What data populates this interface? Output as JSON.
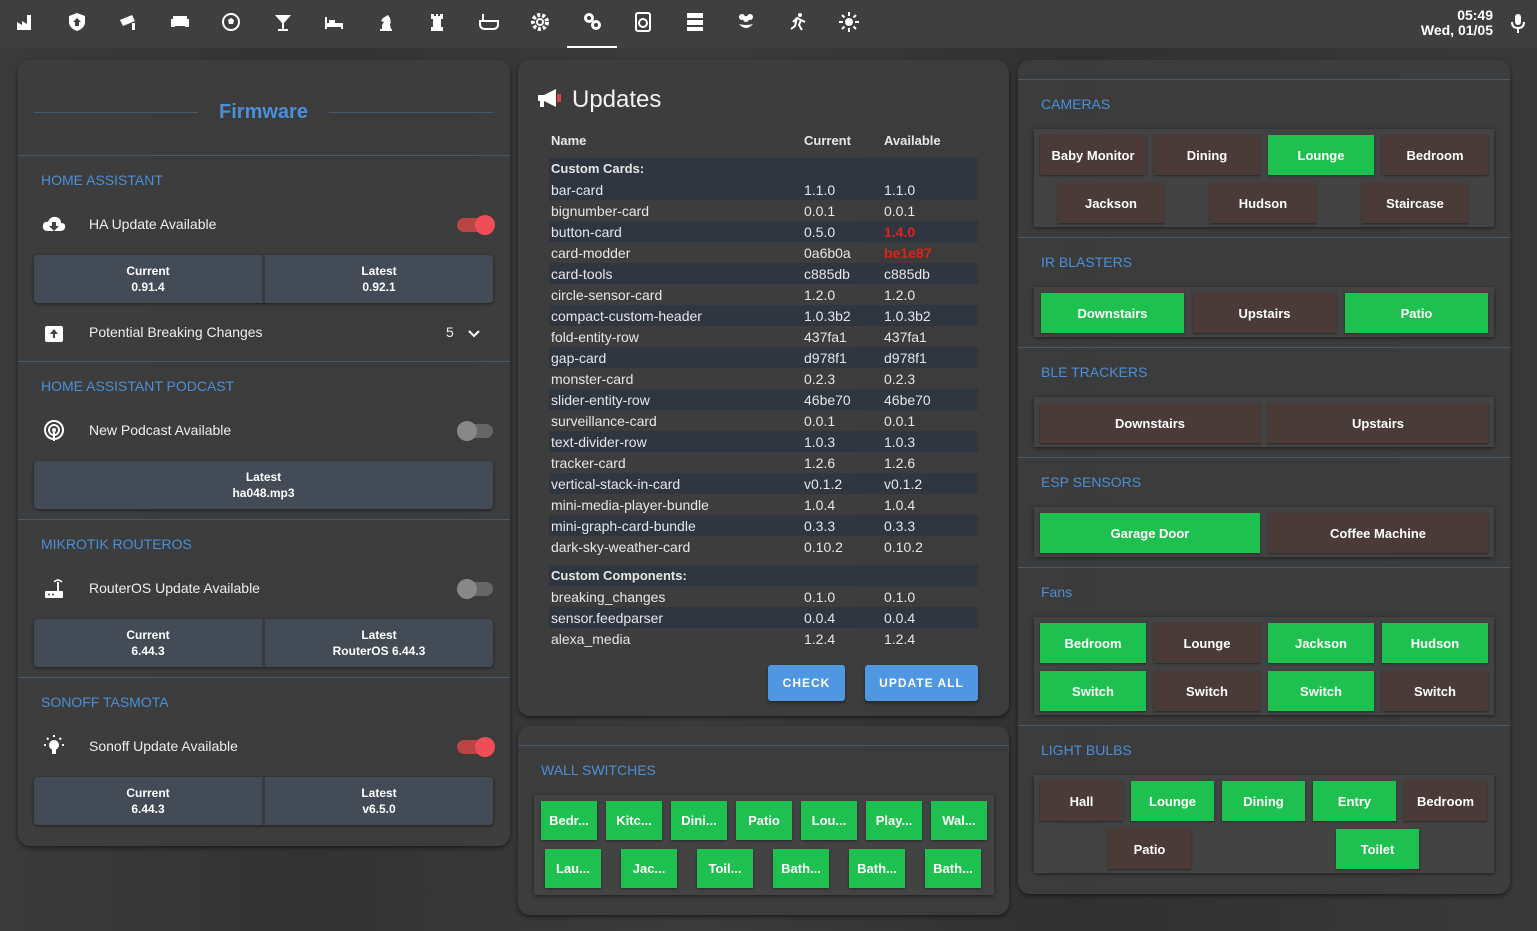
{
  "topbar": {
    "tabs": [
      "factory-icon",
      "shield-home-icon",
      "cctv-icon",
      "sofa-icon",
      "soccer-icon",
      "cocktail-icon",
      "bed-icon",
      "chess-knight-icon",
      "chess-rook-icon",
      "bathtub-icon",
      "cog-icon",
      "cogs-icon",
      "washing-machine-icon",
      "server-icon",
      "flower-icon",
      "run-icon",
      "weather-sunny-icon"
    ],
    "active_tab": 11,
    "time": "05:49",
    "date": "Wed, 01/05"
  },
  "firmware": {
    "title": "Firmware",
    "sections": {
      "ha": {
        "title": "HOME ASSISTANT",
        "label": "HA Update Available",
        "toggle_on": true,
        "current_label": "Current",
        "current_value": "0.91.4",
        "latest_label": "Latest",
        "latest_value": "0.92.1",
        "breaking_label": "Potential Breaking Changes",
        "breaking_count": "5"
      },
      "podcast": {
        "title": "HOME ASSISTANT PODCAST",
        "label": "New Podcast Available",
        "toggle_on": false,
        "latest_label": "Latest",
        "latest_value": "ha048.mp3"
      },
      "mikrotik": {
        "title": "MIKROTIK ROUTEROS",
        "label": "RouterOS Update Available",
        "toggle_on": false,
        "current_label": "Current",
        "current_value": "6.44.3",
        "latest_label": "Latest",
        "latest_value": "RouterOS 6.44.3"
      },
      "sonoff": {
        "title": "SONOFF TASMOTA",
        "label": "Sonoff Update Available",
        "toggle_on": true,
        "current_label": "Current",
        "current_value": "6.44.3",
        "latest_label": "Latest",
        "latest_value": "v6.5.0"
      }
    }
  },
  "updates": {
    "title": "Updates",
    "headers": {
      "name": "Name",
      "current": "Current",
      "available": "Available"
    },
    "cards_heading": "Custom Cards:",
    "cards": [
      {
        "name": "bar-card",
        "current": "1.1.0",
        "available": "1.1.0",
        "outdated": false
      },
      {
        "name": "bignumber-card",
        "current": "0.0.1",
        "available": "0.0.1",
        "outdated": false
      },
      {
        "name": "button-card",
        "current": "0.5.0",
        "available": "1.4.0",
        "outdated": true
      },
      {
        "name": "card-modder",
        "current": "0a6b0a",
        "available": "be1e87",
        "outdated": true
      },
      {
        "name": "card-tools",
        "current": "c885db",
        "available": "c885db",
        "outdated": false
      },
      {
        "name": "circle-sensor-card",
        "current": "1.2.0",
        "available": "1.2.0",
        "outdated": false
      },
      {
        "name": "compact-custom-header",
        "current": "1.0.3b2",
        "available": "1.0.3b2",
        "outdated": false
      },
      {
        "name": "fold-entity-row",
        "current": "437fa1",
        "available": "437fa1",
        "outdated": false
      },
      {
        "name": "gap-card",
        "current": "d978f1",
        "available": "d978f1",
        "outdated": false
      },
      {
        "name": "monster-card",
        "current": "0.2.3",
        "available": "0.2.3",
        "outdated": false
      },
      {
        "name": "slider-entity-row",
        "current": "46be70",
        "available": "46be70",
        "outdated": false
      },
      {
        "name": "surveillance-card",
        "current": "0.0.1",
        "available": "0.0.1",
        "outdated": false
      },
      {
        "name": "text-divider-row",
        "current": "1.0.3",
        "available": "1.0.3",
        "outdated": false
      },
      {
        "name": "tracker-card",
        "current": "1.2.6",
        "available": "1.2.6",
        "outdated": false
      },
      {
        "name": "vertical-stack-in-card",
        "current": "v0.1.2",
        "available": "v0.1.2",
        "outdated": false
      },
      {
        "name": "mini-media-player-bundle",
        "current": "1.0.4",
        "available": "1.0.4",
        "outdated": false
      },
      {
        "name": "mini-graph-card-bundle",
        "current": "0.3.3",
        "available": "0.3.3",
        "outdated": false
      },
      {
        "name": "dark-sky-weather-card",
        "current": "0.10.2",
        "available": "0.10.2",
        "outdated": false
      }
    ],
    "components_heading": "Custom Components:",
    "components": [
      {
        "name": "breaking_changes",
        "current": "0.1.0",
        "available": "0.1.0"
      },
      {
        "name": "sensor.feedparser",
        "current": "0.0.4",
        "available": "0.0.4"
      },
      {
        "name": "alexa_media",
        "current": "1.2.4",
        "available": "1.2.4"
      }
    ],
    "check_label": "CHECK",
    "update_all_label": "UPDATE ALL"
  },
  "wall_switches": {
    "title": "WALL SWITCHES",
    "row1": [
      "Bedr...",
      "Kitc...",
      "Dini...",
      "Patio",
      "Lou...",
      "Play...",
      "Wal..."
    ],
    "row2": [
      "Lau...",
      "Jac...",
      "Toil...",
      "Bath...",
      "Bath...",
      "Bath..."
    ]
  },
  "cameras": {
    "title": "CAMERAS",
    "row1": [
      {
        "label": "Baby Monitor",
        "on": false
      },
      {
        "label": "Dining",
        "on": false
      },
      {
        "label": "Lounge",
        "on": true
      },
      {
        "label": "Bedroom",
        "on": false
      }
    ],
    "row2": [
      {
        "label": "Jackson",
        "on": false
      },
      {
        "label": "Hudson",
        "on": false
      },
      {
        "label": "Staircase",
        "on": false
      }
    ]
  },
  "ir_blasters": {
    "title": "IR BLASTERS",
    "items": [
      {
        "label": "Downstairs",
        "on": true
      },
      {
        "label": "Upstairs",
        "on": false
      },
      {
        "label": "Patio",
        "on": true
      }
    ]
  },
  "ble_trackers": {
    "title": "BLE TRACKERS",
    "items": [
      {
        "label": "Downstairs",
        "on": false
      },
      {
        "label": "Upstairs",
        "on": false
      }
    ]
  },
  "esp_sensors": {
    "title": "ESP SENSORS",
    "items": [
      {
        "label": "Garage Door",
        "on": true
      },
      {
        "label": "Coffee Machine",
        "on": false
      }
    ]
  },
  "fans": {
    "title": "Fans",
    "rooms": [
      {
        "label": "Bedroom",
        "on": true
      },
      {
        "label": "Lounge",
        "on": false
      },
      {
        "label": "Jackson",
        "on": true
      },
      {
        "label": "Hudson",
        "on": true
      }
    ],
    "switches": [
      {
        "label": "Switch",
        "on": true
      },
      {
        "label": "Switch",
        "on": false
      },
      {
        "label": "Switch",
        "on": true
      },
      {
        "label": "Switch",
        "on": false
      }
    ]
  },
  "light_bulbs": {
    "title": "LIGHT BULBS",
    "row1": [
      {
        "label": "Hall",
        "on": false
      },
      {
        "label": "Lounge",
        "on": true
      },
      {
        "label": "Dining",
        "on": true
      },
      {
        "label": "Entry",
        "on": true
      },
      {
        "label": "Bedroom",
        "on": false
      }
    ],
    "row2": [
      {
        "label": "Patio",
        "on": false
      },
      {
        "label": "Toilet",
        "on": true
      }
    ]
  }
}
